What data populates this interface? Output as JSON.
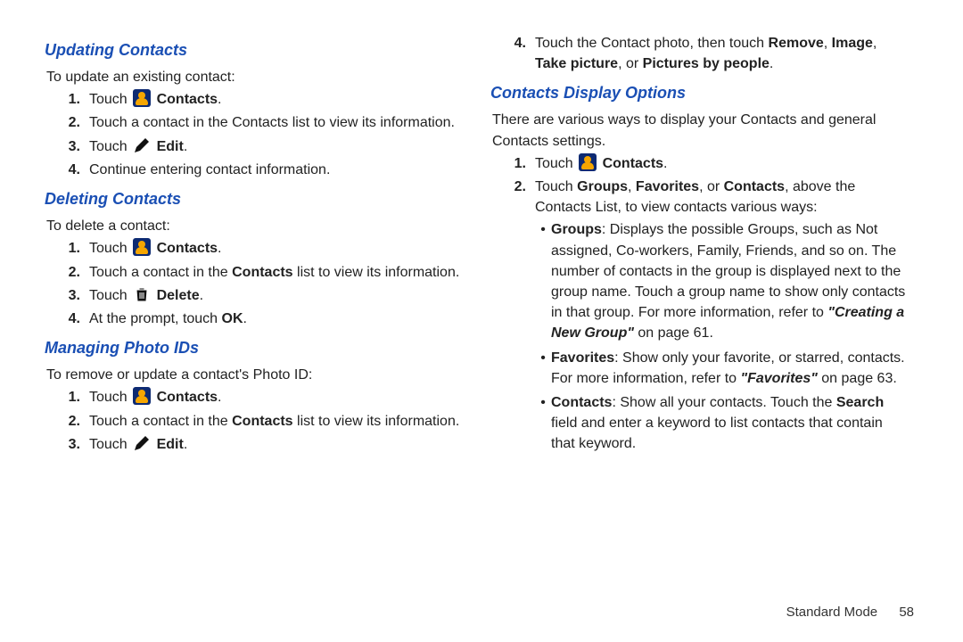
{
  "footer": {
    "mode": "Standard Mode",
    "page": "58"
  },
  "left": {
    "h1": "Updating Contacts",
    "intro1": "To update an existing contact:",
    "s1n": "1.",
    "s1a": "Touch ",
    "s1b": "Contacts",
    "s1c": ".",
    "s2n": "2.",
    "s2": "Touch a contact in the Contacts list to view its information.",
    "s3n": "3.",
    "s3a": "Touch ",
    "s3b": "Edit",
    "s3c": ".",
    "s4n": "4.",
    "s4": "Continue entering contact information.",
    "h2": "Deleting Contacts",
    "intro2": "To delete a contact:",
    "d1n": "1.",
    "d1a": "Touch ",
    "d1b": "Contacts",
    "d1c": ".",
    "d2n": "2.",
    "d2a": "Touch a contact in the ",
    "d2b": "Contacts",
    "d2c": " list to view its information.",
    "d3n": "3.",
    "d3a": "Touch  ",
    "d3b": "Delete",
    "d3c": ".",
    "d4n": "4.",
    "d4a": "At the prompt, touch ",
    "d4b": "OK",
    "d4c": ".",
    "h3": "Managing Photo IDs",
    "intro3": "To remove or update a contact's Photo ID:",
    "p1n": "1.",
    "p1a": "Touch ",
    "p1b": "Contacts",
    "p1c": ".",
    "p2n": "2.",
    "p2a": "Touch a contact in the ",
    "p2b": "Contacts",
    "p2c": " list to view its information.",
    "p3n": "3.",
    "p3a": "Touch ",
    "p3b": "Edit",
    "p3c": "."
  },
  "right": {
    "r4n": "4.",
    "r4a": "Touch the Contact photo, then touch ",
    "r4b1": "Remove",
    "r4c1": ", ",
    "r4b2": "Image",
    "r4c2": ", ",
    "r4b3": "Take picture",
    "r4c3": ", or ",
    "r4b4": "Pictures by people",
    "r4c4": ".",
    "h4": "Contacts Display Options",
    "intro4": "There are various ways to display your Contacts and general Contacts settings.",
    "c1n": "1.",
    "c1a": "Touch ",
    "c1b": "Contacts",
    "c1c": ".",
    "c2n": "2.",
    "c2a": "Touch ",
    "c2b1": "Groups",
    "c2c1": ", ",
    "c2b2": "Favorites",
    "c2c2": ", or ",
    "c2b3": "Contacts",
    "c2c3": ", above the Contacts List, to view contacts various ways:",
    "g_b": "Groups",
    "g_t1": ": Displays the possible Groups, such as Not assigned, Co-workers, Family, Friends, and so on. The number of contacts in the group is displayed next to the group name. Touch a group name to show only contacts in that group. For more information, refer to ",
    "g_q": "\"Creating a New Group\"",
    "g_t2": " on page 61.",
    "f_b": "Favorites",
    "f_t1": ": Show only your favorite, or starred, contacts. For more information, refer to ",
    "f_q": "\"Favorites\"",
    "f_t2": " on page 63.",
    "co_b": "Contacts",
    "co_t1": ": Show all your contacts. Touch the ",
    "co_b2": "Search",
    "co_t2": " field and enter a keyword to list contacts that contain that keyword."
  }
}
